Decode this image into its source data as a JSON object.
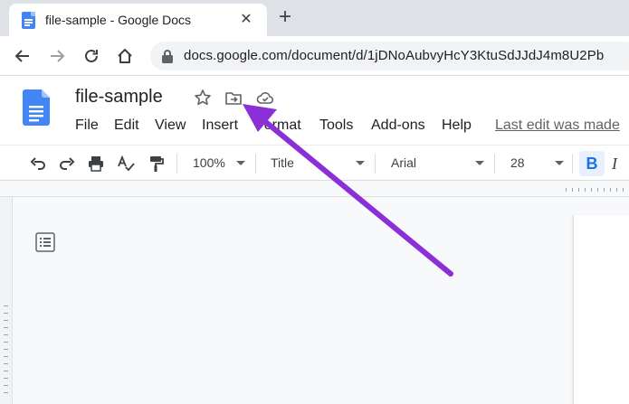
{
  "browser": {
    "tab": {
      "title": "file-sample - Google Docs",
      "close_glyph": "✕"
    },
    "new_tab_glyph": "+",
    "url": "docs.google.com/document/d/1jDNoAubvyHcY3KtuSdJJdJ4m8U2Pb"
  },
  "doc": {
    "title": "file-sample",
    "last_edit": "Last edit was made"
  },
  "menu": {
    "items": [
      "File",
      "Edit",
      "View",
      "Insert",
      "Format",
      "Tools",
      "Add-ons",
      "Help"
    ]
  },
  "toolbar": {
    "zoom": "100%",
    "style": "Title",
    "font": "Arial",
    "size": "28",
    "bold_label": "B",
    "italic_label": "I"
  },
  "colors": {
    "accent": "#1a73e8",
    "docs_blue": "#4285f4",
    "annotation_arrow": "#8b2fd6"
  },
  "icons": [
    "docs-logo-icon",
    "star-icon",
    "move-to-folder-icon",
    "cloud-saved-icon",
    "undo-icon",
    "redo-icon",
    "print-icon",
    "spellcheck-icon",
    "paint-format-icon",
    "document-outline-icon",
    "lock-icon",
    "back-icon",
    "forward-icon",
    "reload-icon",
    "home-icon"
  ]
}
